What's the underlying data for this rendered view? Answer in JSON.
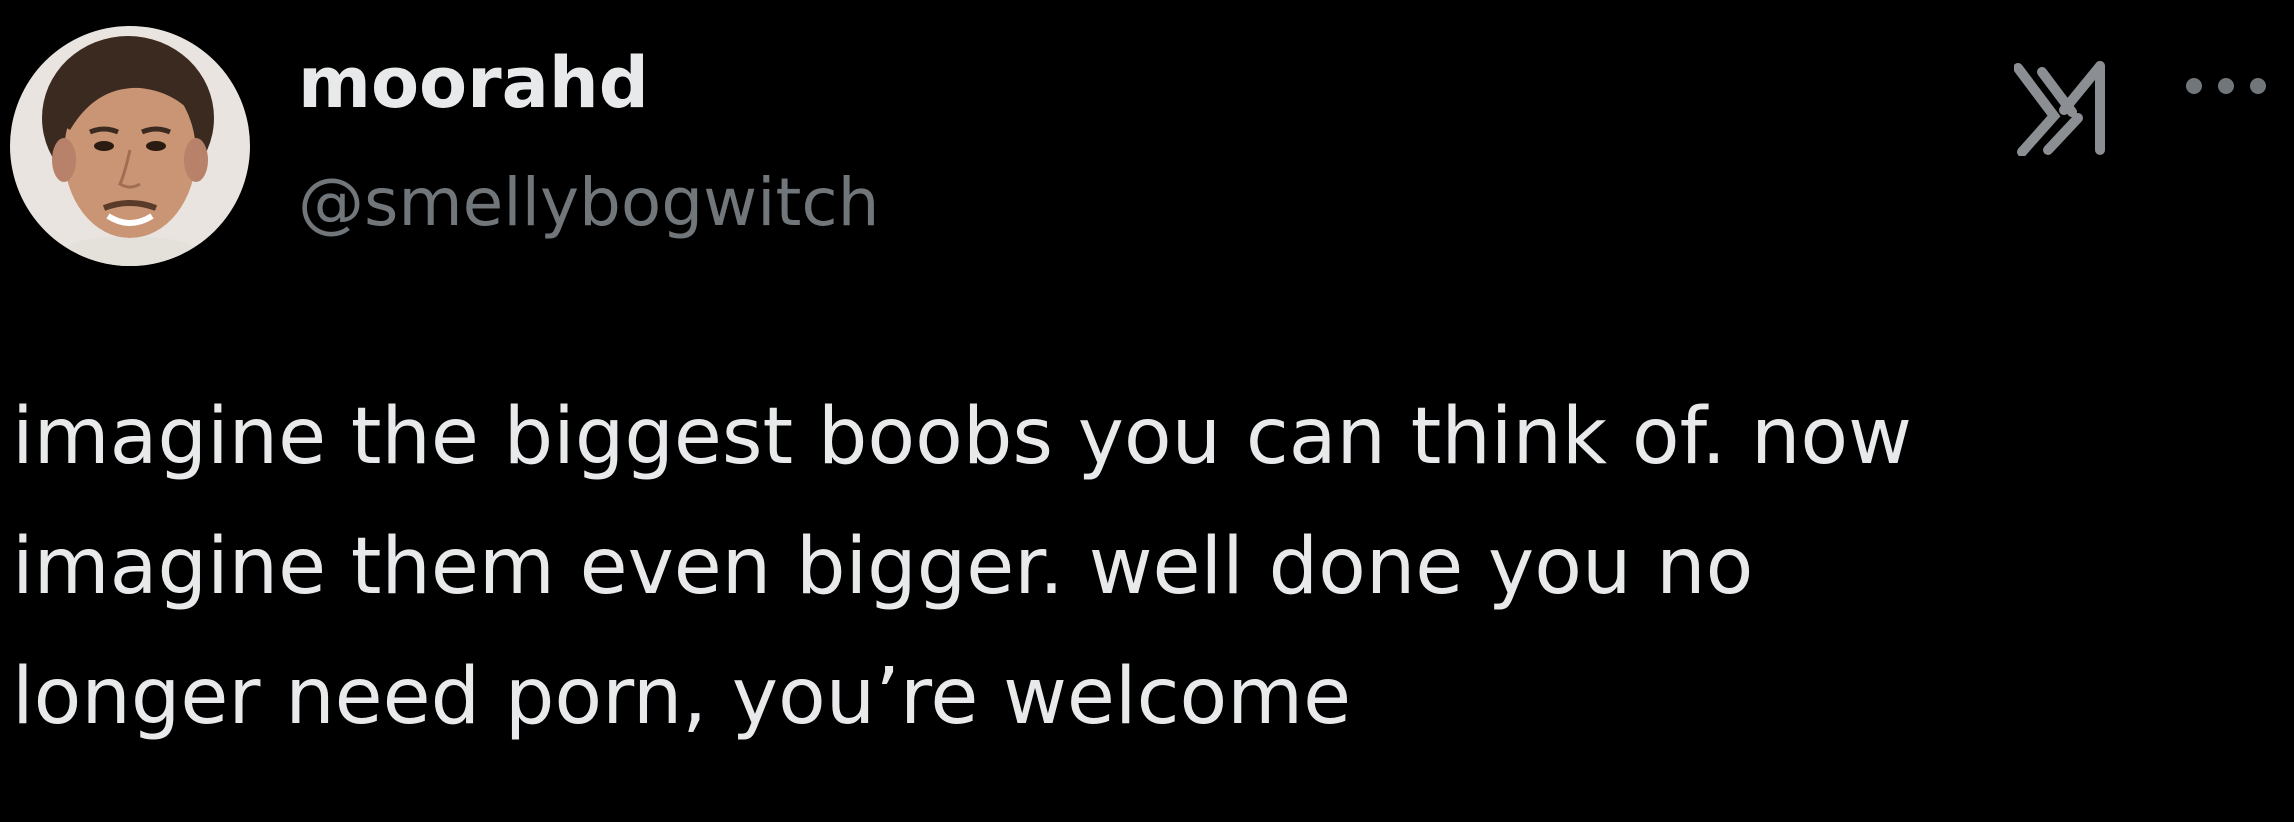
{
  "author": {
    "display_name": "moorahd",
    "handle": "@smellybogwitch",
    "avatar_icon": "user-avatar-photo"
  },
  "header_icons": {
    "brand_icon": "x-logo-icon",
    "more_icon": "more-options-icon"
  },
  "tweet": {
    "lines": [
      "imagine the biggest boobs you can think of. now",
      "imagine them even bigger. well done you no",
      "longer need porn, you’re welcome"
    ]
  },
  "colors": {
    "background": "#000000",
    "primary_text": "#e7e9ea",
    "secondary_text": "#71767b"
  }
}
